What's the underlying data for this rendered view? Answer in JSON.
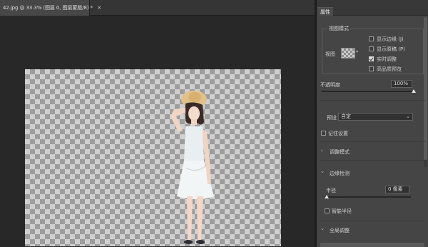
{
  "document": {
    "tab_title": "42.jpg @ 33.3% (图层 0, 图层蒙版/8) *",
    "close_icon": "×"
  },
  "canvas": {
    "subject": "person-cutout"
  },
  "properties": {
    "tab_label": "属性",
    "view_mode": {
      "title": "视图模式",
      "view_label": "视图",
      "show_edge_label": "显示边缘 (J)",
      "show_edge_checked": false,
      "show_original_label": "显示原稿 (P)",
      "show_original_checked": false,
      "realtime_label": "实时调整",
      "realtime_checked": true,
      "hq_preview_label": "高品质预览",
      "hq_preview_checked": false
    },
    "opacity": {
      "label": "不透明度",
      "value": "100%",
      "level": 1.0
    },
    "preset": {
      "label": "预设",
      "value": "自定"
    },
    "remember_label": "记住设置",
    "remember_checked": false,
    "adjust_mode_label": "调整模式",
    "edge_detection_label": "边缘检测",
    "radius": {
      "label": "半径",
      "value": "0 像素",
      "level": 0.0
    },
    "smart_radius_label": "智能半径",
    "smart_radius_checked": false,
    "global_adjust_label": "全局调整"
  },
  "colors": {
    "panel_bg": "#454545",
    "canvas_bg": "#282828"
  }
}
